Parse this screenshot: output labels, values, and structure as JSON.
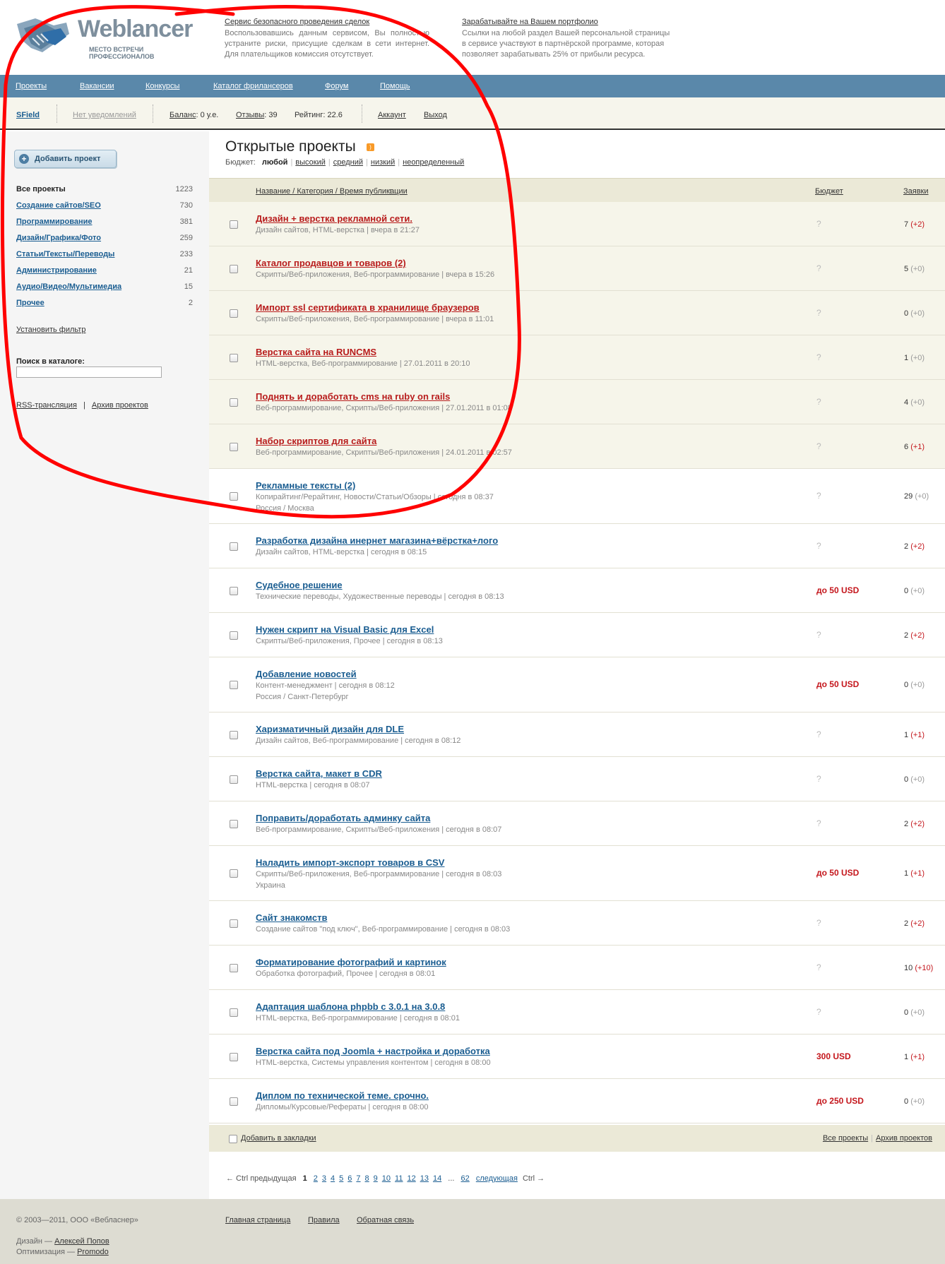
{
  "logo": {
    "name": "Weblancer",
    "tagline": "МЕСТО ВСТРЕЧИ ПРОФЕССИОНАЛОВ"
  },
  "promo1": {
    "title": "Сервис безопасного проведения сделок",
    "text": "Воспользовавшись данным сервисом, Вы полностью устраните риски, присущие сделкам в сети интернет. Для плательщиков комиссия отсутствует."
  },
  "promo2": {
    "title": "Зарабатывайте на Вашем портфолио",
    "text": "Ссылки на любой раздел Вашей персональной страницы в сервисе участвуют в партнёрской программе, которая позволяет зарабатывать 25% от прибыли ресурса."
  },
  "nav": [
    "Проекты",
    "Вакансии",
    "Конкурсы",
    "Каталог фрилансеров",
    "Форум",
    "Помощь"
  ],
  "userbar": {
    "username": "SField",
    "notifications": "Нет уведомлений",
    "balance_label": "Баланс",
    "balance_value": ": 0 у.е.",
    "reviews_label": "Отзывы",
    "reviews_value": ": 39",
    "rating": "Рейтинг: 22.6",
    "account": "Аккаунт",
    "logout": "Выход"
  },
  "sidebar": {
    "add_button": "Добавить проект",
    "categories": [
      {
        "name": "Все проекты",
        "count": "1223"
      },
      {
        "name": "Создание сайтов/SEO",
        "count": "730"
      },
      {
        "name": "Программирование",
        "count": "381"
      },
      {
        "name": "Дизайн/Графика/Фото",
        "count": "259"
      },
      {
        "name": "Статьи/Тексты/Переводы",
        "count": "233"
      },
      {
        "name": "Администрирование",
        "count": "21"
      },
      {
        "name": "Аудио/Видео/Мультимедиа",
        "count": "15"
      },
      {
        "name": "Прочее",
        "count": "2"
      }
    ],
    "filter": "Установить фильтр",
    "search_label": "Поиск в каталоге:",
    "search_value": "",
    "rss": "RSS-трансляция",
    "archive": "Архив проектов"
  },
  "main": {
    "title": "Открытые проекты",
    "budget_label": "Бюджет:",
    "budget_options": [
      "любой",
      "высокий",
      "средний",
      "низкий",
      "неопределенный"
    ],
    "columns": {
      "name": "Название / Категория / Время публикации",
      "budget": "Бюджет",
      "bids": "Заявки"
    },
    "projects": [
      {
        "title": "Дизайн + верстка рекламной сети.",
        "meta": "Дизайн сайтов, HTML-верстка | вчера в 21:27",
        "location": "",
        "budget": "?",
        "bids": "7",
        "delta": "(+2)"
      },
      {
        "title": "Каталог продавцов и товаров (2)",
        "meta": "Скрипты/Веб-приложения, Веб-программирование | вчера в 15:26",
        "location": "",
        "budget": "?",
        "bids": "5",
        "delta": "(+0)"
      },
      {
        "title": "Импорт ssl сертификата в хранилище браузеров",
        "meta": "Скрипты/Веб-приложения, Веб-программирование | вчера в 11:01",
        "location": "",
        "budget": "?",
        "bids": "0",
        "delta": "(+0)"
      },
      {
        "title": "Верстка сайта на RUNCMS",
        "meta": "HTML-верстка, Веб-программирование | 27.01.2011 в 20:10",
        "location": "",
        "budget": "?",
        "bids": "1",
        "delta": "(+0)"
      },
      {
        "title": "Поднять и доработать cms на ruby on rails",
        "meta": "Веб-программирование, Скрипты/Веб-приложения | 27.01.2011 в 01:08",
        "location": "",
        "budget": "?",
        "bids": "4",
        "delta": "(+0)"
      },
      {
        "title": "Набор скриптов для сайта",
        "meta": "Веб-программирование, Скрипты/Веб-приложения | 24.01.2011 в 02:57",
        "location": "",
        "budget": "?",
        "bids": "6",
        "delta": "(+1)"
      },
      {
        "title": "Рекламные тексты (2)",
        "meta": "Копирайтинг/Рерайтинг, Новости/Статьи/Обзоры | сегодня в 08:37",
        "location": "Россия / Москва",
        "budget": "?",
        "bids": "29",
        "delta": "(+0)"
      },
      {
        "title": "Разработка дизайна инернет магазина+вёрстка+лого",
        "meta": "Дизайн сайтов, HTML-верстка | сегодня в 08:15",
        "location": "",
        "budget": "?",
        "bids": "2",
        "delta": "(+2)"
      },
      {
        "title": "Судебное решение",
        "meta": "Технические переводы, Художественные переводы | сегодня в 08:13",
        "location": "",
        "budget": "до 50 USD",
        "bids": "0",
        "delta": "(+0)"
      },
      {
        "title": "Нужен скрипт на Visual Basic для Excel",
        "meta": "Скрипты/Веб-приложения, Прочее | сегодня в 08:13",
        "location": "",
        "budget": "?",
        "bids": "2",
        "delta": "(+2)"
      },
      {
        "title": "Добавление новостей",
        "meta": "Контент-менеджмент | сегодня в 08:12",
        "location": "Россия / Санкт-Петербург",
        "budget": "до 50 USD",
        "bids": "0",
        "delta": "(+0)"
      },
      {
        "title": "Харизматичный дизайн для DLE",
        "meta": "Дизайн сайтов, Веб-программирование | сегодня в 08:12",
        "location": "",
        "budget": "?",
        "bids": "1",
        "delta": "(+1)"
      },
      {
        "title": "Верстка сайта, макет в CDR",
        "meta": "HTML-верстка | сегодня в 08:07",
        "location": "",
        "budget": "?",
        "bids": "0",
        "delta": "(+0)"
      },
      {
        "title": "Поправить/доработать админку сайта",
        "meta": "Веб-программирование, Скрипты/Веб-приложения | сегодня в 08:07",
        "location": "",
        "budget": "?",
        "bids": "2",
        "delta": "(+2)"
      },
      {
        "title": "Наладить импорт-экспорт товаров в CSV",
        "meta": "Скрипты/Веб-приложения, Веб-программирование | сегодня в 08:03",
        "location": "Украина",
        "budget": "до 50 USD",
        "bids": "1",
        "delta": "(+1)"
      },
      {
        "title": "Сайт знакомств",
        "meta": "Создание сайтов \"под ключ\", Веб-программирование | сегодня в 08:03",
        "location": "",
        "budget": "?",
        "bids": "2",
        "delta": "(+2)"
      },
      {
        "title": "Форматирование фотографий и картинок",
        "meta": "Обработка фотографий, Прочее | сегодня в 08:01",
        "location": "",
        "budget": "?",
        "bids": "10",
        "delta": "(+10)"
      },
      {
        "title": "Адаптация шаблона phpbb с 3.0.1 на 3.0.8",
        "meta": "HTML-верстка, Веб-программирование | сегодня в 08:01",
        "location": "",
        "budget": "?",
        "bids": "0",
        "delta": "(+0)"
      },
      {
        "title": "Верстка сайта под Joomla + настройка и доработка",
        "meta": "HTML-верстка, Системы управления контентом | сегодня в 08:00",
        "location": "",
        "budget": "300 USD",
        "bids": "1",
        "delta": "(+1)"
      },
      {
        "title": "Диплом по технической теме. срочно.",
        "meta": "Дипломы/Курсовые/Рефераты | сегодня в 08:00",
        "location": "",
        "budget": "до 250 USD",
        "bids": "0",
        "delta": "(+0)"
      }
    ],
    "bookmark": "Добавить в закладки",
    "all_projects": "Все проекты",
    "archive": "Архив проектов"
  },
  "pager": {
    "prev": "← Ctrl предыдущая",
    "current": "1",
    "pages": [
      "2",
      "3",
      "4",
      "5",
      "6",
      "7",
      "8",
      "9",
      "10",
      "11",
      "12",
      "13",
      "14"
    ],
    "ellipsis": "...",
    "last": "62",
    "next": "следующая",
    "next_suffix": "Ctrl →"
  },
  "footer": {
    "copyright": "© 2003—2011, ООО «Вебласнер»",
    "links": [
      "Главная страница",
      "Правила",
      "Обратная связь"
    ],
    "design_label": "Дизайн —",
    "design_author": "Алексей Попов",
    "opt_label": "Оптимизация —",
    "opt_author": "Promodo"
  },
  "colors": {
    "nav": "#5a88aa",
    "highlight_title": "#b81c1c",
    "link": "#1a5d91",
    "annotation": "#ff0000"
  }
}
